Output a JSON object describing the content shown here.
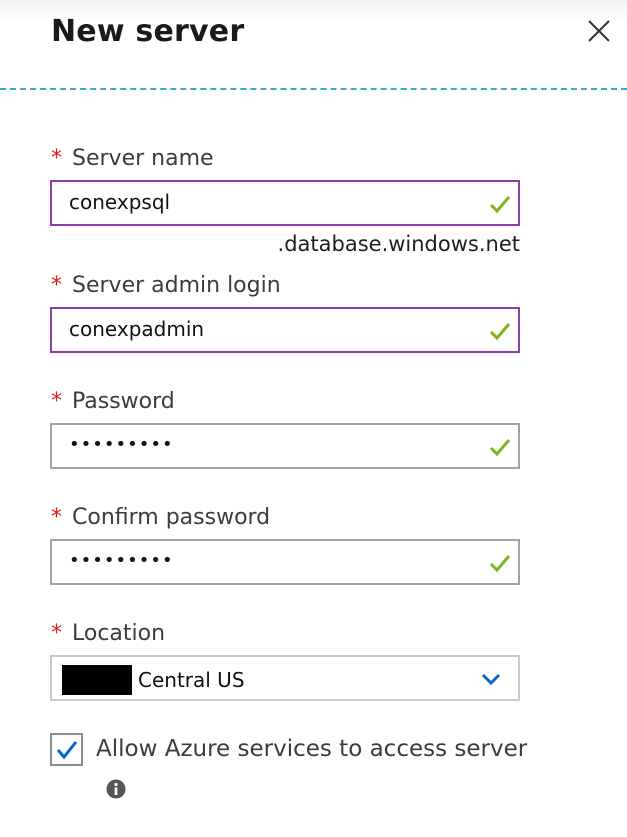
{
  "header": {
    "title": "New server",
    "close_icon": "close-icon"
  },
  "required_marker": "*",
  "server_name": {
    "label": "Server name",
    "value": "conexpsql",
    "suffix": ".database.windows.net",
    "valid": true
  },
  "admin_login": {
    "label": "Server admin login",
    "value": "conexpadmin",
    "valid": true
  },
  "password": {
    "label": "Password",
    "masked_value": "•••••••••",
    "valid": true
  },
  "confirm_password": {
    "label": "Confirm password",
    "masked_value": "•••••••••",
    "valid": true
  },
  "location": {
    "label": "Location",
    "selected": "Central US",
    "dropdown_icon": "chevron-down-icon"
  },
  "allow_azure": {
    "label": "Allow Azure services to access server",
    "checked": true,
    "info_icon": "info-icon"
  },
  "colors": {
    "accent_border": "#8f3cad",
    "valid_check": "#7cb81c",
    "required_star": "#d81e1e",
    "divider": "#35a9d9",
    "checkbox_check": "#0a64c8",
    "chevron": "#0a64c8"
  }
}
